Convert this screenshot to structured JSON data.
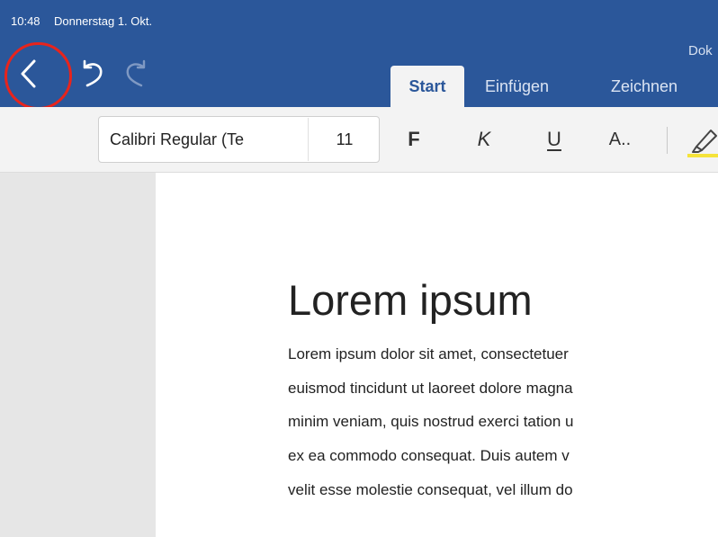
{
  "status_bar": {
    "time": "10:48",
    "date": "Donnerstag 1. Okt."
  },
  "header": {
    "doc_title": "Dok",
    "back_icon": "chevron-left-icon",
    "undo_icon": "undo-icon",
    "redo_icon": "redo-icon",
    "tabs": [
      {
        "label": "Start",
        "active": true
      },
      {
        "label": "Einfügen",
        "active": false
      },
      {
        "label": "Zeichnen",
        "active": false
      }
    ]
  },
  "toolbar": {
    "font_name": "Calibri Regular (Te",
    "font_size": "11",
    "bold_label": "F",
    "italic_label": "K",
    "underline_label": "U",
    "font_color_label": "A..",
    "highlighter_icon": "highlighter-icon"
  },
  "document": {
    "heading": "Lorem ipsum",
    "lines": [
      "Lorem ipsum dolor sit amet, consectetuer",
      "euismod tincidunt ut laoreet dolore magna",
      "minim veniam, quis nostrud exerci tation u",
      "ex ea commodo consequat. Duis autem v",
      "velit esse molestie consequat, vel illum do"
    ]
  },
  "colors": {
    "ribbon": "#2b579a",
    "annotation": "#e8241c",
    "toolbar_bg": "#f3f3f3",
    "gutter": "#e6e6e6"
  }
}
